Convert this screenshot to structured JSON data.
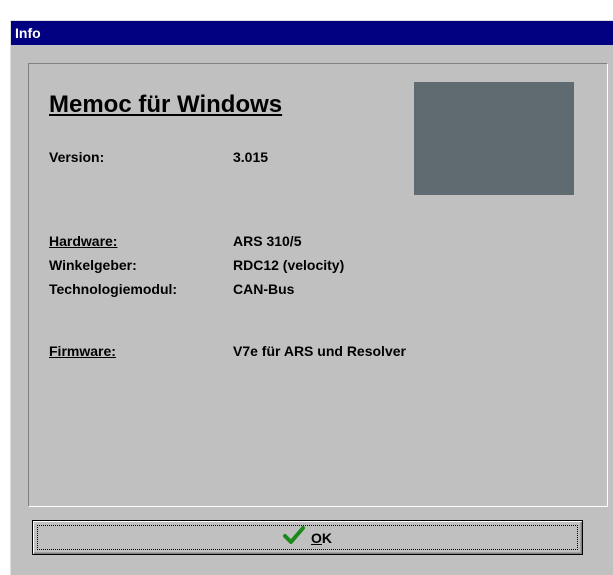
{
  "window": {
    "title": "Info"
  },
  "app": {
    "title": "Memoc für Windows"
  },
  "info": {
    "version_label": "Version:",
    "version_value": "3.015",
    "hardware_label": "Hardware:",
    "hardware_value": "ARS 310/5",
    "encoder_label": "Winkelgeber:",
    "encoder_value": "RDC12 (velocity)",
    "module_label": "Technologiemodul:",
    "module_value": "CAN-Bus",
    "firmware_label": "Firmware:",
    "firmware_value": "V7e für ARS und Resolver"
  },
  "logo": {
    "color": "#5f6b70"
  },
  "ok_button": {
    "mnemonic": "O",
    "rest": "K",
    "icon": "checkmark-icon",
    "icon_color": "#1a8a1a"
  }
}
